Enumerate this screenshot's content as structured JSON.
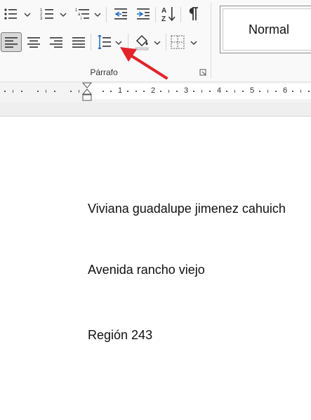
{
  "ribbon": {
    "group_label": "Párrafo",
    "style_gallery": {
      "current_style": "Normal"
    },
    "buttons": {
      "bullets": "bullets-icon",
      "numbering": "numbering-icon",
      "multilevel": "multilevel-list-icon",
      "decrease_indent": "decrease-indent-icon",
      "increase_indent": "increase-indent-icon",
      "sort": "sort-az-icon",
      "show_marks": "pilcrow-icon",
      "align_left": "align-left-icon",
      "align_center": "align-center-icon",
      "align_right": "align-right-icon",
      "justify": "justify-icon",
      "line_spacing": "line-spacing-icon",
      "shading": "shading-icon",
      "borders": "borders-icon"
    },
    "selected_button": "align_left"
  },
  "ruler": {
    "numbers": [
      "1",
      "2",
      "3",
      "4",
      "5",
      "6"
    ]
  },
  "document": {
    "lines": [
      "Viviana guadalupe jimenez cahuich",
      "Avenida rancho viejo",
      "Región 243"
    ]
  },
  "annotation": {
    "arrow_color": "#e3242b"
  }
}
